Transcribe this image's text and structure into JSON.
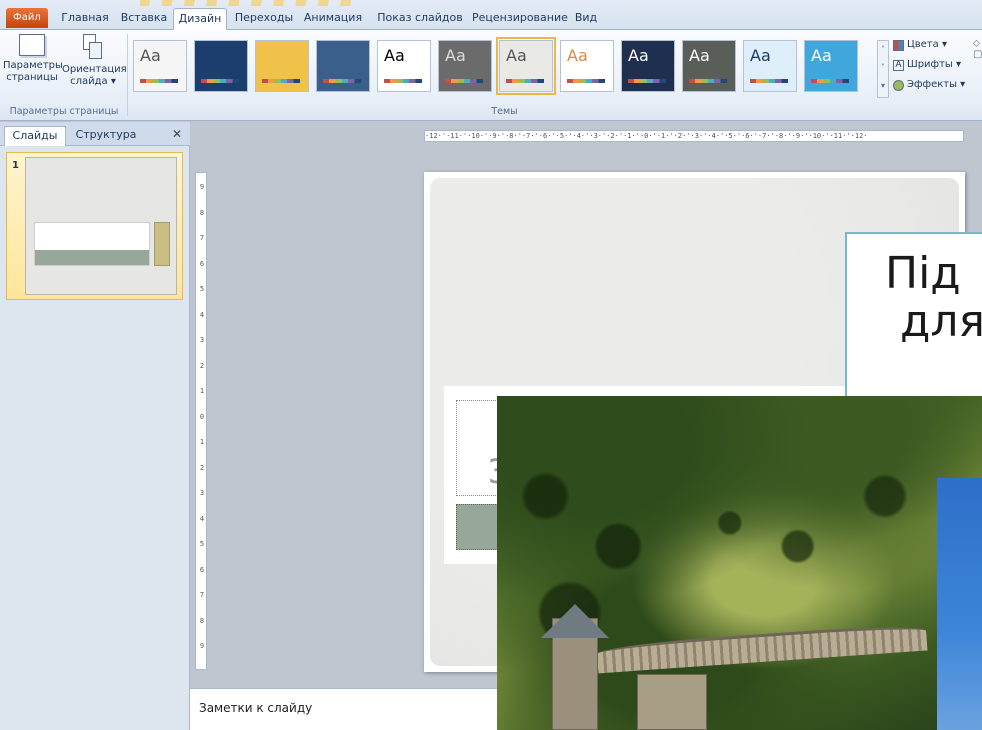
{
  "ribbon": {
    "tabs": [
      {
        "label": "Файл"
      },
      {
        "label": "Главная"
      },
      {
        "label": "Вставка"
      },
      {
        "label": "Дизайн"
      },
      {
        "label": "Переходы"
      },
      {
        "label": "Анимация"
      },
      {
        "label": "Показ слайдов"
      },
      {
        "label": "Рецензирование"
      },
      {
        "label": "Вид"
      }
    ],
    "active_tab": "Дизайн",
    "page_setup": {
      "params_label": "Параметры страницы",
      "orientation_label": "Ориентация слайда ▾",
      "group_label": "Параметры страницы"
    },
    "themes": {
      "group_label": "Темы",
      "items": [
        {
          "text": "Aa",
          "bg": "#f5f5f5",
          "fg": "#555555"
        },
        {
          "text": "",
          "bg": "#1c3e6e",
          "fg": "#ffffff"
        },
        {
          "text": "",
          "bg": "#f0c24a",
          "fg": "#ffffff"
        },
        {
          "text": "",
          "bg": "#3a5f8a",
          "fg": "#ffffff"
        },
        {
          "text": "Aa",
          "bg": "#ffffff",
          "fg": "#000000"
        },
        {
          "text": "Aa",
          "bg": "#6b6b6b",
          "fg": "#dddddd"
        },
        {
          "text": "Aa",
          "bg": "#e9e9e6",
          "fg": "#555555"
        },
        {
          "text": "Aa",
          "bg": "#ffffff",
          "fg": "#e08a3c"
        },
        {
          "text": "Aa",
          "bg": "#1f2f4f",
          "fg": "#ffffff"
        },
        {
          "text": "Aa",
          "bg": "#5a5e58",
          "fg": "#ffffff"
        },
        {
          "text": "Aa",
          "bg": "#dfeefb",
          "fg": "#1e3a6a"
        },
        {
          "text": "Aa",
          "bg": "#3fa7db",
          "fg": "#ffffff"
        }
      ],
      "selected_index": 6
    },
    "theme_options": {
      "colors_label": "Цвета ▾",
      "fonts_label": "Шрифты ▾",
      "effects_label": "Эффекты ▾"
    }
  },
  "slides_pane": {
    "tab_slides": "Слайды",
    "tab_outline": "Структура",
    "close_glyph": "✕",
    "slide_number": "1"
  },
  "ruler": {
    "horizontal_ticks": "·12·'·11·'·10·'·9·'·8·'·7·'·6·'·5·'·4·'·3·'·2·'·1·'·0·'·1·'·2·'·3·'·4·'·5·'·6·'·7·'·8·'·9·'·10·'·11·'·12·",
    "vertical_ticks": [
      "9",
      "8",
      "7",
      "6",
      "5",
      "4",
      "3",
      "2",
      "1",
      "0",
      "1",
      "2",
      "3",
      "4",
      "5",
      "6",
      "7",
      "8",
      "9"
    ]
  },
  "slide": {
    "ghost_text": "З"
  },
  "overlay": {
    "caption_line1": "Під",
    "caption_line2": "для"
  },
  "notes": {
    "placeholder": "Заметки к слайду"
  },
  "colors": {
    "ribbon_bg": "#e7eef7",
    "accent_orange": "#c44511",
    "selection": "#e8b94a",
    "subtitle_band": "#97a79a"
  }
}
